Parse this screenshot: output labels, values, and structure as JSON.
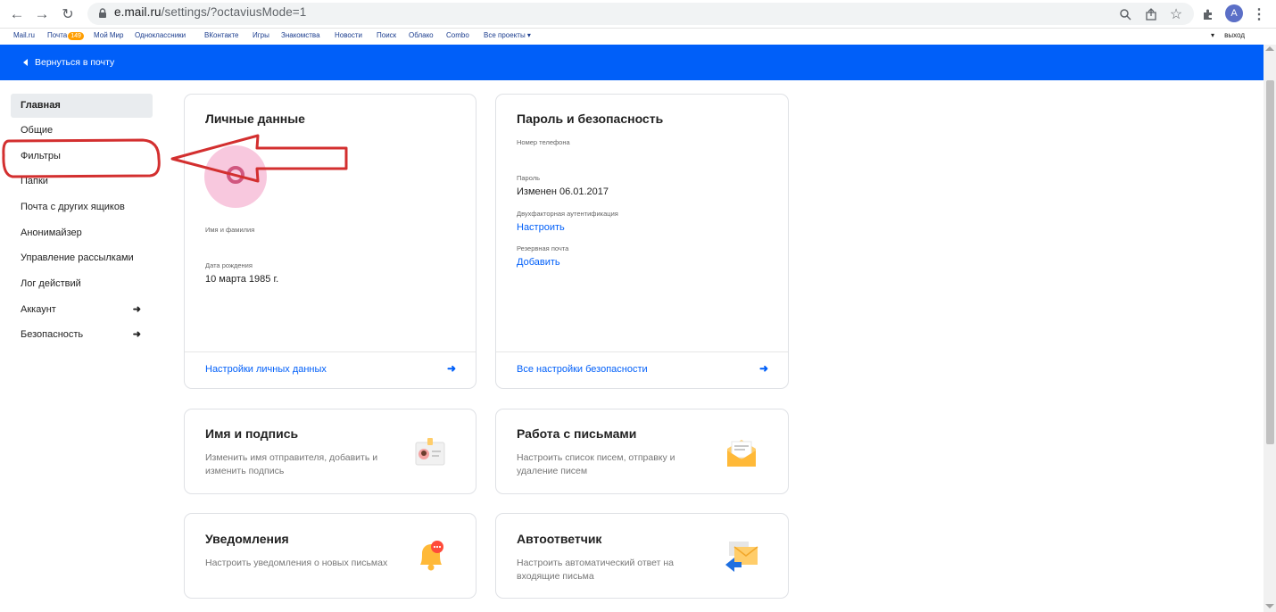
{
  "browser": {
    "url_host": "e.mail.ru",
    "url_path": "/settings/?octaviusMode=1",
    "profile_initial": "A"
  },
  "portal": {
    "links": [
      "Mail.ru",
      "Почта",
      "Мой Мир",
      "Одноклассники",
      "ВКонтакте",
      "Игры",
      "Знакомства",
      "Новости",
      "Поиск",
      "Облако",
      "Combo",
      "Все проекты ▾"
    ],
    "mail_count": "149",
    "logout_label": "выход",
    "logout_prefix": "▾"
  },
  "header": {
    "back_label": "Вернуться в почту"
  },
  "sidebar": {
    "items": [
      {
        "label": "Главная"
      },
      {
        "label": "Общие"
      },
      {
        "label": "Фильтры"
      },
      {
        "label": "Папки"
      },
      {
        "label": "Почта с других ящиков"
      },
      {
        "label": "Анонимайзер"
      },
      {
        "label": "Управление рассылками"
      },
      {
        "label": "Лог действий"
      },
      {
        "label": "Аккаунт",
        "arrow": "➜"
      },
      {
        "label": "Безопасность",
        "arrow": "➜"
      }
    ]
  },
  "personal": {
    "title": "Личные данные",
    "name_label": "Имя и фамилия",
    "birth_label": "Дата рождения",
    "birth_value": "10 марта 1985 г.",
    "footer_link": "Настройки личных данных",
    "footer_arrow": "➜"
  },
  "security": {
    "title": "Пароль и безопасность",
    "phone_label": "Номер телефона",
    "password_label": "Пароль",
    "password_value": "Изменен 06.01.2017",
    "twofa_label": "Двухфакторная аутентификация",
    "twofa_action": "Настроить",
    "backup_label": "Резервная почта",
    "backup_action": "Добавить",
    "footer_link": "Все настройки безопасности",
    "footer_arrow": "➜"
  },
  "cards": [
    {
      "title": "Имя и подпись",
      "desc": "Изменить имя отправителя, добавить и изменить подпись",
      "icon": "signature-icon"
    },
    {
      "title": "Работа с письмами",
      "desc": "Настроить список писем, отправку и удаление писем",
      "icon": "letter-icon"
    },
    {
      "title": "Уведомления",
      "desc": "Настроить уведомления о новых письмах",
      "icon": "bell-icon"
    },
    {
      "title": "Автоответчик",
      "desc": "Настроить автоматический ответ на входящие письма",
      "icon": "autoreply-icon"
    }
  ],
  "colors": {
    "brand_blue": "#005ff9",
    "annotation_red": "#d32f2f"
  }
}
